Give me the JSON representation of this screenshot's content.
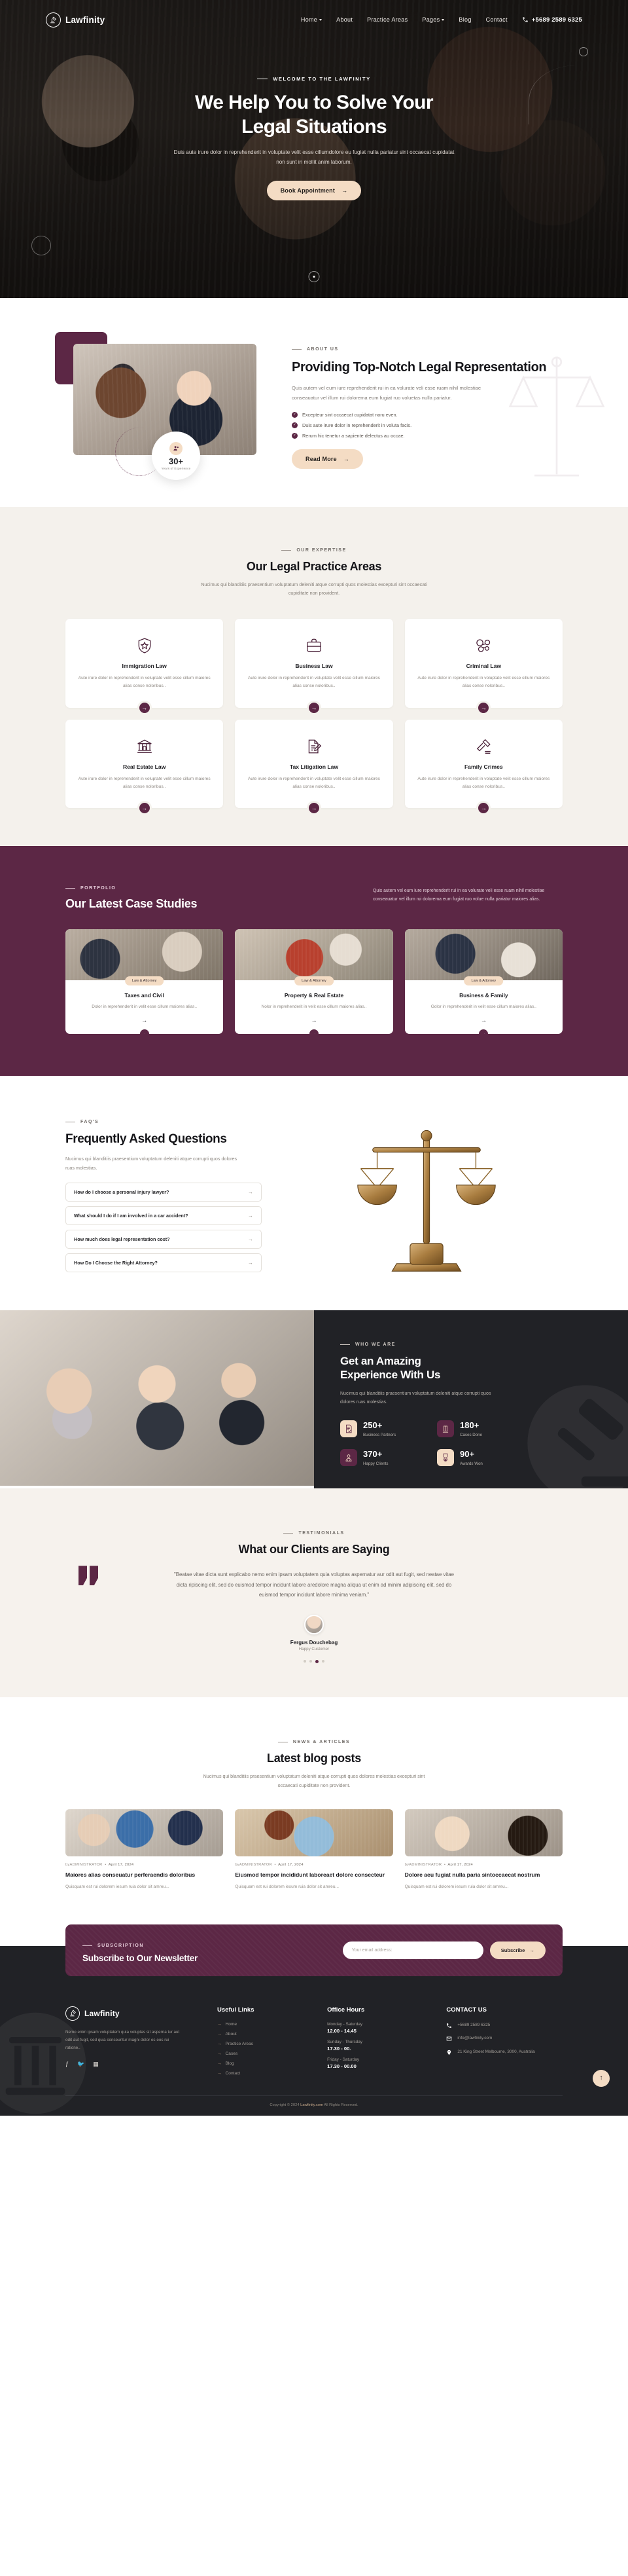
{
  "brand": {
    "name": "Lawfinity",
    "icon": "gavel-circle-icon"
  },
  "nav": {
    "items": [
      {
        "label": "Home",
        "has_dropdown": true
      },
      {
        "label": "About",
        "has_dropdown": false
      },
      {
        "label": "Practice Areas",
        "has_dropdown": false
      },
      {
        "label": "Pages",
        "has_dropdown": true
      },
      {
        "label": "Blog",
        "has_dropdown": false
      },
      {
        "label": "Contact",
        "has_dropdown": false
      }
    ],
    "phone": "+5689 2589 6325"
  },
  "hero": {
    "eyebrow": "WELCOME TO THE LAWFINITY",
    "title_line1": "We Help You to Solve Your",
    "title_line2": "Legal Situations",
    "paragraph": "Duis aute irure dolor in reprehenderit in voluptate velit esse cillumdolore eu fugiat nulla pariatur sint occaecat cupidatat non sunt in mollit anim laborum.",
    "cta": "Book Appointment"
  },
  "about": {
    "eyebrow": "ABOUT US",
    "title": "Providing Top-Notch Legal Representation",
    "paragraph": "Quis autem vel eum iure reprehenderit rui in ea volurate veli esse ruam nihil molestiae conseauatur vel illum rui dolorema eum fugiat ruo voluetas nulla pariatur.",
    "bullets": [
      "Excepteur sint occaecat cupidatat noru even.",
      "Duis aute irure dolor in reprehenderit in voluta facis.",
      "Rerum hic tenetur a sapiente delectus au occae."
    ],
    "cta": "Read More",
    "badge_number": "30+",
    "badge_label": "Years of Experience"
  },
  "practice": {
    "eyebrow": "OUR EXPERTISE",
    "title": "Our Legal Practice Areas",
    "subtitle": "Nucimus qui blanditiis praesentium voluptatum deleniti atque corrupti quos molestias excepturi sint occaecati cupiditate non provident.",
    "cards": [
      {
        "title": "Immigration Law",
        "text": "Aute irure dolor in reprehenderit in voluptate velit esse cillum maiores alias conse noloribus..",
        "icon": "shield-star-icon"
      },
      {
        "title": "Business Law",
        "text": "Aute irure dolor in reprehenderit in voluptate velit esse cillum maiores alias conse noloribus..",
        "icon": "briefcase-icon"
      },
      {
        "title": "Criminal Law",
        "text": "Aute irure dolor in reprehenderit in voluptate velit esse cillum maiores alias conse noloribus..",
        "icon": "handcuffs-icon"
      },
      {
        "title": "Real Estate Law",
        "text": "Aute irure dolor in reprehenderit in voluptate velit esse cillum maiores alias conse noloribus..",
        "icon": "bank-building-icon"
      },
      {
        "title": "Tax Litigation Law",
        "text": "Aute irure dolor in reprehenderit in voluptate velit esse cillum maiores alias conse noloribus..",
        "icon": "document-pen-icon"
      },
      {
        "title": "Family Crimes",
        "text": "Aute irure dolor in reprehenderit in voluptate velit esse cillum maiores alias conse noloribus..",
        "icon": "gavel-icon"
      }
    ]
  },
  "cases": {
    "eyebrow": "PORTFOLIO",
    "title": "Our Latest Case Studies",
    "paragraph": "Quis autem vel eum iure reprehenderit rui in ea volurate veli esse ruam nihil molestiae conseauatur vel illum rui dolorema eum fugiat ruo volue nulla pariatur maiores alias.",
    "items": [
      {
        "tag": "Law & Attorney",
        "title": "Taxes and Civil",
        "text": "Dolor in reprehenderit in velit esse cillum maiores alias.."
      },
      {
        "tag": "Law & Attorney",
        "title": "Property & Real Estate",
        "text": "Nolor in reprehenderit in velit esse cillum maiores alias.."
      },
      {
        "tag": "Law & Attorney",
        "title": "Business & Family",
        "text": "Golor in reprehenderit in velit esse cillum maiores alias.."
      }
    ]
  },
  "faq": {
    "eyebrow": "FAQ'S",
    "title": "Frequently Asked Questions",
    "paragraph": "Nucimus qui blanditiis praesentium voluptatum deleniti atque corrupti quos dolores ruas molestias.",
    "questions": [
      "How do I choose a personal injury lawyer?",
      "What should I do if I am involved in a car accident?",
      "How much does legal representation cost?",
      "How Do I Choose the Right Attorney?"
    ]
  },
  "stats": {
    "eyebrow": "WHO WE ARE",
    "title_line1": "Get an Amazing",
    "title_line2": "Experience With Us",
    "paragraph": "Nucimus qui blanditiis praesentium voluptatum deleniti atque corrupti quos dolores ruas molestias.",
    "items": [
      {
        "number": "250+",
        "label": "Business Partners",
        "icon": "contract-icon",
        "style": "cream"
      },
      {
        "number": "180+",
        "label": "Cases Done",
        "icon": "pillar-icon",
        "style": "plum"
      },
      {
        "number": "370+",
        "label": "Happy Clients",
        "icon": "judge-icon",
        "style": "plum"
      },
      {
        "number": "90+",
        "label": "Awards Won",
        "icon": "medal-icon",
        "style": "cream"
      }
    ]
  },
  "testimonials": {
    "eyebrow": "TESTIMONIALS",
    "title": "What our Clients are Saying",
    "quote": "\"Beatae vitae dicta sunt explicabo nemo enim ipsam voluptatem quia voluptas aspernatur aur odit aut fugit, sed neatae vitae dicta ripiscing elit, sed do euismod tempor incidunt labore aredolore magna aliqua ut enim ad minim adipiscing elit, sed do euismod tempor incidunt labore minima veniam.\"",
    "author": "Fergus Douchebag",
    "role": "Happy Customer",
    "active_dot": 2,
    "dot_count": 4
  },
  "blog": {
    "eyebrow": "NEWS & ARTICLES",
    "title": "Latest blog posts",
    "subtitle": "Nucimus qui blanditiis praesentium voluptatum deleniti atque corrupti quos dolores molestias excepturi sint occaecati cupiditate non provident.",
    "posts": [
      {
        "author": "byADMINISTRATOR",
        "date": "April 17, 2024",
        "title": "Maiores alias conseuatur perferaendis doloribus",
        "excerpt": "Quisquam est rui dolorem iesum ruia dolor sit amreu..."
      },
      {
        "author": "byADMINISTRATOR",
        "date": "April 17, 2024",
        "title": "Eiusmod tempor incididunt laboreaet dolore consecteur",
        "excerpt": "Quisquam est rui dolorem iesum ruia dolor sit amreu..."
      },
      {
        "author": "byADMINISTRATOR",
        "date": "April 17, 2024",
        "title": "Dolore aeu fugiat nulla paria sintoccaecat nostrum",
        "excerpt": "Quisquam est rui dolorem iesum ruia dolor sit amreu..."
      }
    ]
  },
  "newsletter": {
    "eyebrow": "SUBSCRIPTION",
    "title": "Subscribe to Our Newsletter",
    "placeholder": "Your email address:",
    "button": "Subscribe"
  },
  "footer": {
    "about": "Nemo enim ipsam voluptatem quia voluptas sit asperna tur aut odit aut fugit, sed quia conseuntur magni dolor es eos rui ratione..",
    "social": [
      "facebook-icon",
      "twitter-icon",
      "linkedin-icon"
    ],
    "links_title": "Useful Links",
    "links": [
      "Home",
      "About",
      "Practice Areas",
      "Cases",
      "Blog",
      "Contact"
    ],
    "hours_title": "Office Hours",
    "hours": [
      {
        "days": "Monday - Saturday",
        "time": "12.00 - 14.45"
      },
      {
        "days": "Sunday - Thursday",
        "time": "17.30 - 00."
      },
      {
        "days": "Friday - Saturday",
        "time": "17.30 - 00.00"
      }
    ],
    "contact_title": "CONTACT US",
    "contact": [
      {
        "icon": "phone-icon",
        "text": "+5689 2589 6325"
      },
      {
        "icon": "mail-icon",
        "text": "info@lawfinity.com"
      },
      {
        "icon": "location-pin-icon",
        "text": "21 King Street Melbourne, 3000, Australia"
      }
    ],
    "copyright_pre": "Copyright © 2024 ",
    "copyright_brand": "Lawfinity.com",
    "copyright_post": " All Rights Reserved."
  },
  "colors": {
    "plum": "#5c2745",
    "cream": "#f4dcc4",
    "dark": "#212226",
    "beige": "#f4f1ec"
  }
}
